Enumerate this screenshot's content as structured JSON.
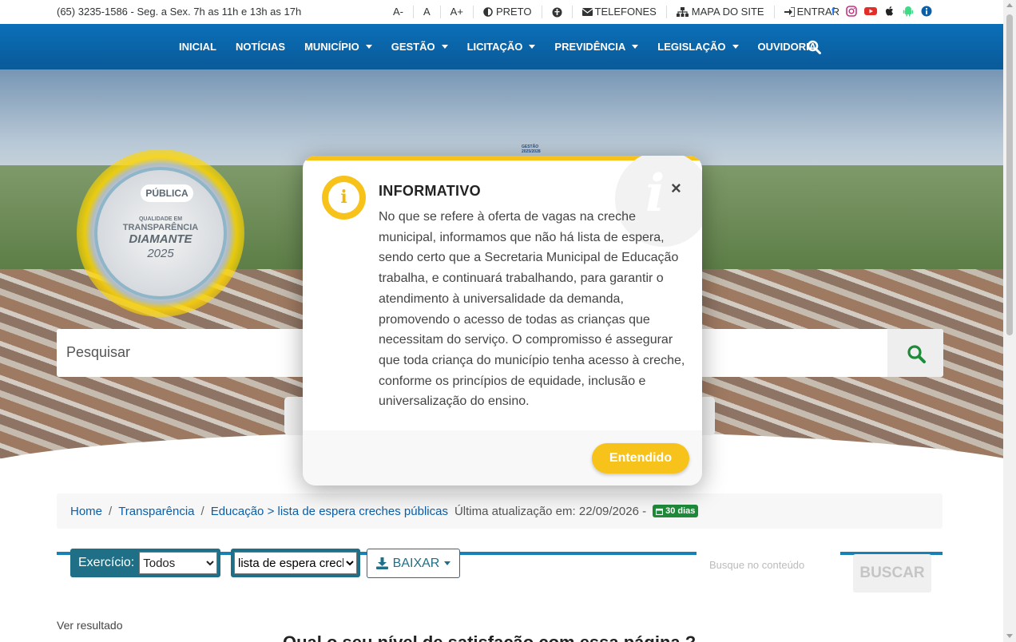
{
  "topbar": {
    "contact": "(65) 3235-1586 - Seg. a Sex. 7h as 11h e 13h as 17h",
    "font_decrease": "A-",
    "font_normal": "A",
    "font_increase": "A+",
    "contrast": "PRETO",
    "phones": "TELEFONES",
    "sitemap": "MAPA DO SITE",
    "login": "ENTRAR",
    "socials": [
      "facebook",
      "instagram",
      "youtube",
      "apple",
      "android",
      "info"
    ]
  },
  "nav": {
    "items": [
      {
        "label": "INICIAL",
        "dropdown": false
      },
      {
        "label": "NOTÍCIAS",
        "dropdown": false
      },
      {
        "label": "MUNICÍPIO",
        "dropdown": true
      },
      {
        "label": "GESTÃO",
        "dropdown": true
      },
      {
        "label": "LICITAÇÃO",
        "dropdown": true
      },
      {
        "label": "PREVIDÊNCIA",
        "dropdown": true
      },
      {
        "label": "LEGISLAÇÃO",
        "dropdown": true
      },
      {
        "label": "OUVIDORIA",
        "dropdown": false
      }
    ]
  },
  "hero": {
    "seal": {
      "badge": "PÚBLICA",
      "line1": "QUALIDADE EM",
      "line2": "TRANSPARÊNCIA",
      "line3": "DIAMANTE",
      "year": "2025"
    },
    "logo_caption": "GESTÃO 2025/2028",
    "search_placeholder": "Pesquisar"
  },
  "breadcrumb": {
    "home": "Home",
    "transparencia": "Transparência",
    "current": "Educação > lista de espera creches públicas",
    "updated": "Última atualização em: 22/09/2026 -",
    "badge": "30 dias"
  },
  "filters": {
    "exercicio_label": "Exercício:",
    "exercicio_value": "Todos",
    "category_value": "lista de espera creches públicas",
    "download": "BAIXAR",
    "content_search_placeholder": "Busque no conteúdo",
    "search_button": "BUSCAR"
  },
  "results": {
    "see_result": "Ver resultado",
    "question": "Qual o seu nível de satisfação com essa página ?"
  },
  "modal": {
    "title": "INFORMATIVO",
    "body": "No que se refere à oferta de vagas na creche municipal, informamos que não há lista de espera, sendo certo que a Secretaria Municipal de Educação trabalha, e continuará trabalhando, para garantir o atendimento à universalidade da demanda, promovendo o acesso de todas as crianças que necessitam do serviço. O compromisso é assegurar que toda criança do município tenha acesso à creche, conforme os princípios de equidade, inclusão e universalização do ensino.",
    "close": "×",
    "confirm": "Entendido"
  },
  "colors": {
    "nav_blue": "#0b6fb8",
    "accent_yellow": "#f7c31a",
    "filter_teal": "#1f6f87",
    "badge_green": "#1f8a3a",
    "link_blue": "#0b5fa8"
  }
}
